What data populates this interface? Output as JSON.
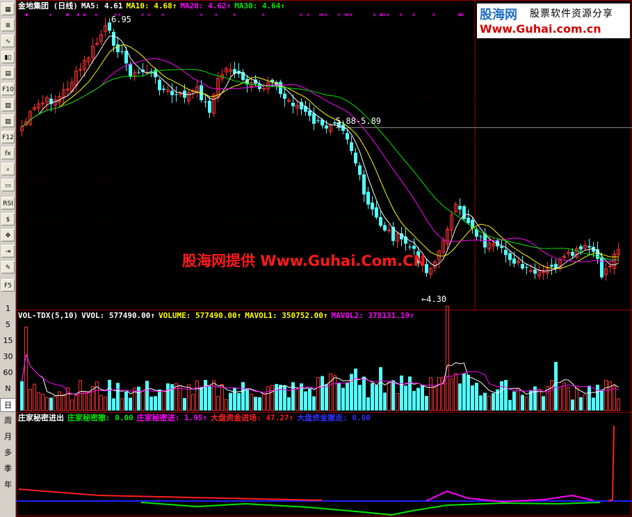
{
  "toolbar": {
    "buttons": [
      {
        "label": "▦",
        "name": "grid-icon"
      },
      {
        "label": "≣",
        "name": "list-icon"
      },
      {
        "label": "∿",
        "name": "line-chart-icon"
      },
      {
        "label": "▮▯",
        "name": "kline-icon"
      },
      {
        "label": "▤",
        "name": "table-icon"
      },
      {
        "label": "F10",
        "name": "f10-icon"
      },
      {
        "label": "▧",
        "name": "report-icon"
      },
      {
        "label": "▨",
        "name": "info-icon"
      },
      {
        "label": "F12",
        "name": "f12-icon"
      },
      {
        "label": "fx",
        "name": "formula-icon"
      },
      {
        "label": "⌕",
        "name": "search-icon"
      },
      {
        "label": "▭",
        "name": "indicator-icon"
      },
      {
        "label": "RSI",
        "name": "rsi-icon"
      },
      {
        "label": "$",
        "name": "money-icon"
      },
      {
        "label": "✥",
        "name": "move-icon"
      },
      {
        "label": "⇥",
        "name": "export-icon"
      },
      {
        "label": "✎",
        "name": "pencil-icon"
      },
      {
        "label": "F5",
        "name": "f5-icon"
      }
    ],
    "periods": [
      "1",
      "5",
      "15",
      "30",
      "60",
      "N",
      "日",
      "周",
      "月",
      "多",
      "季",
      "年"
    ],
    "active_period": "日"
  },
  "logo": {
    "brand": "股海网",
    "slogan": "股票软件资源分享",
    "url": "Www.Guhai.com.cn"
  },
  "watermark": "股海网提供 Www.Guhai.Com.CN",
  "price_panel": {
    "title": "金地集团 (日线)",
    "ma5": "MA5: 4.61",
    "ma10": "MA10: 4.68↑",
    "ma20": "MA20: 4.62↑",
    "ma30": "MA30: 4.64↑",
    "high_label": "6.95",
    "low_label": "←4.30",
    "range_label": "5.88-5.89"
  },
  "volume_panel": {
    "title": "VOL-TDX(5,10)",
    "vvol": "VVOL: 577490.00↑",
    "volume": "VOLUME: 577490.00↑",
    "mavol1": "MAVOL1: 350752.00↑",
    "mavol2": "MAVOL2: 378131.19↑"
  },
  "indicator_panel": {
    "title": "庄家秘密进出",
    "v1": "庄家秘密撤: 0.00",
    "v2": "庄家秘密进: 1.95↑",
    "v3": "大盘资金进场: 47.27↑",
    "v4": "大盘资金撤走: 0.00"
  },
  "colors": {
    "up": "#ff3232",
    "down": "#54fcfc",
    "ma5": "#ffffff",
    "ma10": "#ffff00",
    "ma20": "#ff00ff",
    "ma30": "#00e600",
    "grid": "#a00000",
    "volbar": "#54fcfc"
  }
}
